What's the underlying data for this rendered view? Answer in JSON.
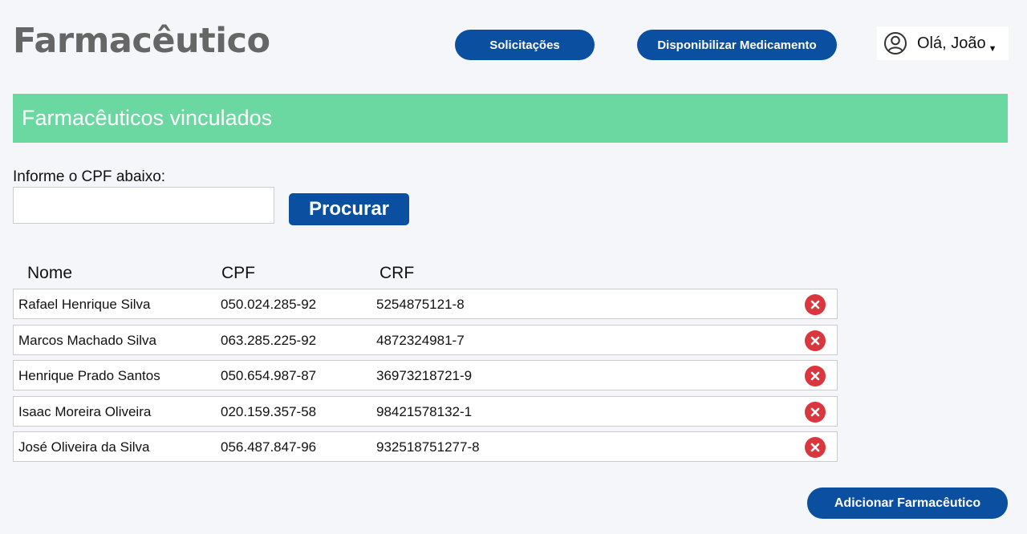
{
  "header": {
    "title": "Farmacêutico",
    "nav": {
      "solicitacoes": "Solicitações",
      "disponibilizar": "Disponibilizar Medicamento"
    },
    "user": {
      "greeting": "Olá, João",
      "icon": "user-circle-icon",
      "caret": "▼"
    }
  },
  "banner": {
    "title": "Farmacêuticos vinculados",
    "color": "#6bd7a1"
  },
  "search": {
    "label": "Informe o CPF abaixo:",
    "value": "",
    "placeholder": "",
    "button": "Procurar"
  },
  "table": {
    "columns": [
      "Nome",
      "CPF",
      "CRF"
    ],
    "rows": [
      {
        "nome": "Rafael Henrique Silva",
        "cpf": "050.024.285-92",
        "crf": "5254875121-8"
      },
      {
        "nome": "Marcos Machado Silva",
        "cpf": "063.285.225-92",
        "crf": "4872324981-7"
      },
      {
        "nome": "Henrique Prado Santos",
        "cpf": "050.654.987-87",
        "crf": "36973218721-9"
      },
      {
        "nome": "Isaac Moreira Oliveira",
        "cpf": "020.159.357-58",
        "crf": "98421578132-1"
      },
      {
        "nome": "José Oliveira da Silva",
        "cpf": "056.487.847-96",
        "crf": "932518751277-8"
      }
    ],
    "remove_icon": "remove-x-icon"
  },
  "actions": {
    "add": "Adicionar Farmacêutico"
  },
  "colors": {
    "primary": "#0a4fa0",
    "danger": "#d9363e",
    "accent": "#6bd7a1"
  }
}
